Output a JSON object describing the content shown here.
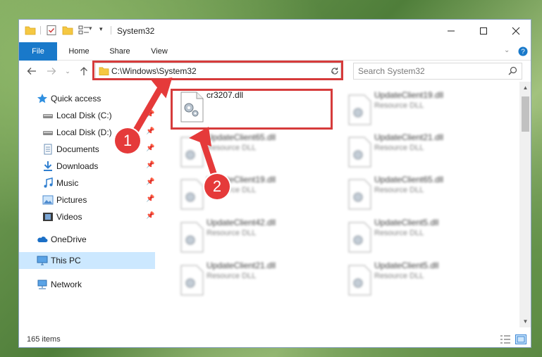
{
  "window": {
    "title": "System32",
    "controls": {
      "minimize": "minimize",
      "maximize": "maximize",
      "close": "close"
    }
  },
  "ribbon": {
    "tabs": [
      {
        "label": "File"
      },
      {
        "label": "Home"
      },
      {
        "label": "Share"
      },
      {
        "label": "View"
      }
    ]
  },
  "nav": {
    "address": "C:\\Windows\\System32",
    "search_placeholder": "Search System32"
  },
  "sidebar": {
    "items": [
      {
        "label": "Quick access",
        "icon": "star-icon",
        "pinned": false
      },
      {
        "label": "Local Disk (C:)",
        "icon": "drive-icon",
        "pinned": true
      },
      {
        "label": "Local Disk (D:)",
        "icon": "drive-icon",
        "pinned": true
      },
      {
        "label": "Documents",
        "icon": "documents-icon",
        "pinned": true
      },
      {
        "label": "Downloads",
        "icon": "download-icon",
        "pinned": true
      },
      {
        "label": "Music",
        "icon": "music-icon",
        "pinned": true
      },
      {
        "label": "Pictures",
        "icon": "pictures-icon",
        "pinned": true
      },
      {
        "label": "Videos",
        "icon": "videos-icon",
        "pinned": true
      },
      {
        "label": "OneDrive",
        "icon": "onedrive-icon",
        "pinned": false
      },
      {
        "label": "This PC",
        "icon": "monitor-icon",
        "pinned": false,
        "selected": true
      },
      {
        "label": "Network",
        "icon": "network-icon",
        "pinned": false
      }
    ]
  },
  "files": [
    {
      "name": "cr3207.dll",
      "type": "",
      "highlighted": true
    },
    {
      "name": "UpdateClient19.dll",
      "type": "Resource DLL"
    },
    {
      "name": "UpdateClient65.dll",
      "type": "Resource DLL"
    },
    {
      "name": "UpdateClient21.dll",
      "type": "Resource DLL"
    },
    {
      "name": "UpdateClient19.dll",
      "type": "Resource DLL"
    },
    {
      "name": "UpdateClient65.dll",
      "type": "Resource DLL"
    },
    {
      "name": "UpdateClient42.dll",
      "type": "Resource DLL"
    },
    {
      "name": "UpdateClient5.dll",
      "type": "Resource DLL"
    },
    {
      "name": "UpdateClient21.dll",
      "type": "Resource DLL"
    },
    {
      "name": "UpdateClient5.dll",
      "type": "Resource DLL"
    }
  ],
  "status": {
    "item_count": "165 items"
  },
  "annotations": {
    "step1": "1",
    "step2": "2",
    "color": "#e53a3a"
  }
}
